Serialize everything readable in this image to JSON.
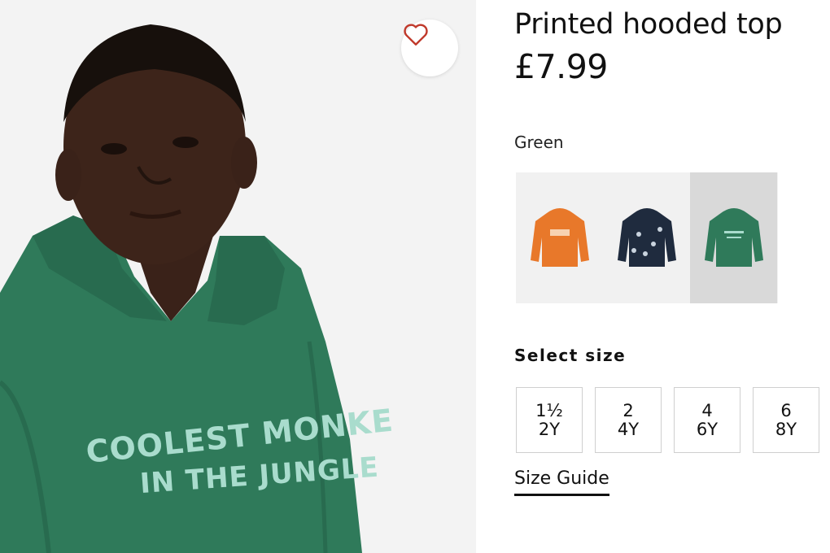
{
  "product": {
    "title": "Printed hooded top",
    "price": "£7.99",
    "selected_color": "Green",
    "shirt_print_line1": "COOLEST MONKE",
    "shirt_print_line2": "IN THE JUNGLE"
  },
  "favorite": {
    "icon": "heart-icon",
    "color": "#c0392b"
  },
  "swatches": [
    {
      "name": "orange-hoodie",
      "color": "#e8782a",
      "selected": false
    },
    {
      "name": "navy-print-hoodie",
      "color": "#1f2b3e",
      "selected": false
    },
    {
      "name": "green-hoodie",
      "color": "#2f7a5a",
      "selected": true
    }
  ],
  "size": {
    "heading": "Select size",
    "options": [
      {
        "line1": "1½",
        "line2": "2Y"
      },
      {
        "line1": "2",
        "line2": "4Y"
      },
      {
        "line1": "4",
        "line2": "6Y"
      },
      {
        "line1": "6",
        "line2": "8Y"
      }
    ],
    "guide_label": "Size Guide"
  }
}
